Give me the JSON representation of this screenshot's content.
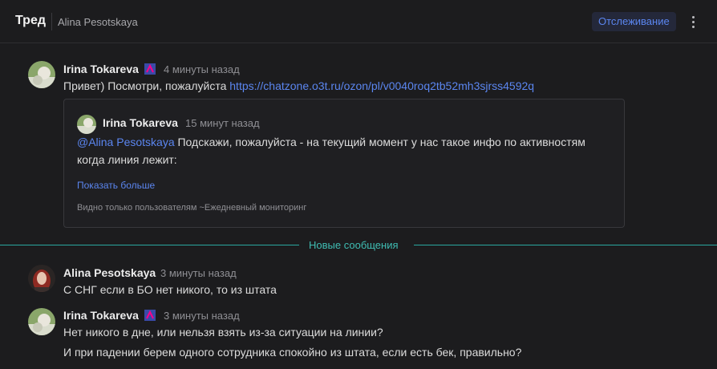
{
  "header": {
    "title": "Тред",
    "channel": "Alina Pesotskaya",
    "follow_label": "Отслеживание"
  },
  "messages": [
    {
      "author": "Irina Tokareva",
      "time": "4 минуты назад",
      "text": "Привет) Посмотри, пожалуйста ",
      "link": "https://chatzone.o3t.ru/ozon/pl/v0040roq2tb52mh3sjrss4592q",
      "quote": {
        "author": "Irina Tokareva",
        "time": "15 минут назад",
        "mention": "@Alina Pesotskaya",
        "text_line1": " Подскажи, пожалуйста - на текущий момент у нас такое инфо по активностям",
        "text_line2": "когда линия лежит:",
        "show_more": "Показать больше",
        "visibility": "Видно только пользователям ~Ежедневный мониторинг"
      }
    },
    {
      "author": "Alina Pesotskaya",
      "time": "3 минуты назад",
      "text": "С СНГ если в БО нет никого, то из штата"
    },
    {
      "author": "Irina Tokareva",
      "time": "3 минуты назад",
      "text_line1": "Нет никого в дне, или нельзя взять из-за ситуации на линии?",
      "text_line2": "И при падении берем одного сотрудника спокойно из штата, если есть бек, правильно?"
    }
  ],
  "divider": {
    "label": "Новые сообщения"
  },
  "colors": {
    "accent": "#5b86f0",
    "divider": "#2aa8a0",
    "background": "#1c1c1e"
  },
  "icons": [
    "more-vertical-icon",
    "flag-badge-icon"
  ]
}
